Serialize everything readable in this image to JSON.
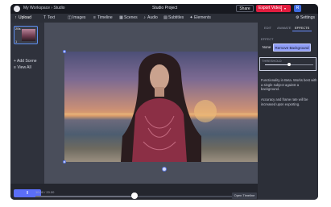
{
  "topbar": {
    "breadcrumb": "My Workspace › Studio",
    "project_name": "Studio Project",
    "share_label": "Share",
    "export_label": "Export Video",
    "export_caret": "▾",
    "avatar_letter": "R"
  },
  "toolbar": {
    "items": [
      {
        "label": "Upload",
        "icon": "↑"
      },
      {
        "label": "Text",
        "icon": "T"
      },
      {
        "label": "Images",
        "icon": "◫"
      },
      {
        "label": "Timeline",
        "icon": "≡"
      },
      {
        "label": "Scenes",
        "icon": "▦"
      },
      {
        "label": "Audio",
        "icon": "♪"
      },
      {
        "label": "Subtitles",
        "icon": "▤"
      },
      {
        "label": "Elements",
        "icon": "✦"
      }
    ],
    "settings_label": "Settings",
    "settings_icon": "⚙"
  },
  "sidebar": {
    "scene_duration": "20s",
    "scene_number": "1",
    "add_scene_label": "Add Scene",
    "add_scene_icon": "+",
    "view_all_label": "View All",
    "view_all_icon": "≡"
  },
  "panel": {
    "tabs": [
      "EDIT",
      "ANIMATE",
      "EFFECTS"
    ],
    "active_tab": "EFFECTS",
    "effect_label": "EFFECT",
    "none_label": "None",
    "remove_bg_label": "Remove Background",
    "threshold_label": "THRESHOLD",
    "threshold_value": 0.5,
    "desc1": "Functionality in Beta. Works best with a single subject against a background.",
    "desc2": "Accuracy and frame rate will be increased upon exporting."
  },
  "timeline": {
    "play_icon": "II",
    "time_display": "10.00 / 20.00",
    "progress": 0.5,
    "open_timeline_label": "Open Timeline"
  },
  "colors": {
    "accent": "#5b6ef7",
    "export": "#e21d3f",
    "selection": "#8f9df7"
  }
}
